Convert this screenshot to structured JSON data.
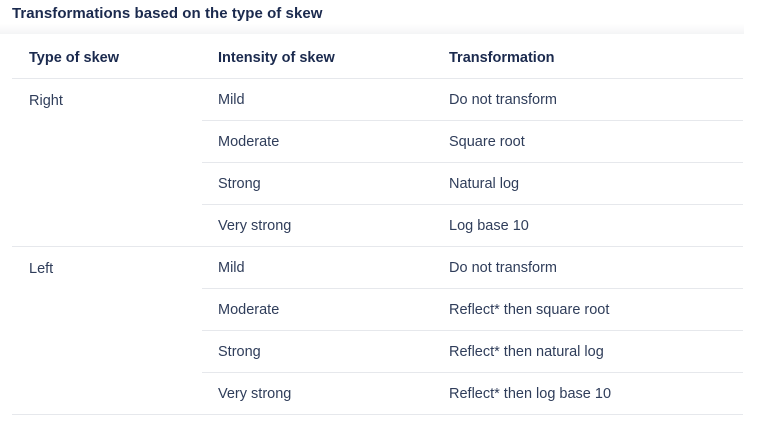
{
  "caption": "Transformations based on the type of skew",
  "headers": {
    "type": "Type of skew",
    "intensity": "Intensity of skew",
    "transformation": "Transformation"
  },
  "groups": [
    {
      "type": "Right",
      "rows": [
        {
          "intensity": "Mild",
          "transformation": "Do not transform"
        },
        {
          "intensity": "Moderate",
          "transformation": "Square root"
        },
        {
          "intensity": "Strong",
          "transformation": "Natural log"
        },
        {
          "intensity": "Very strong",
          "transformation": "Log base 10"
        }
      ]
    },
    {
      "type": "Left",
      "rows": [
        {
          "intensity": "Mild",
          "transformation": "Do not transform"
        },
        {
          "intensity": "Moderate",
          "transformation": "Reflect* then square root"
        },
        {
          "intensity": "Strong",
          "transformation": "Reflect* then natural log"
        },
        {
          "intensity": "Very strong",
          "transformation": "Reflect* then log base 10"
        }
      ]
    }
  ]
}
